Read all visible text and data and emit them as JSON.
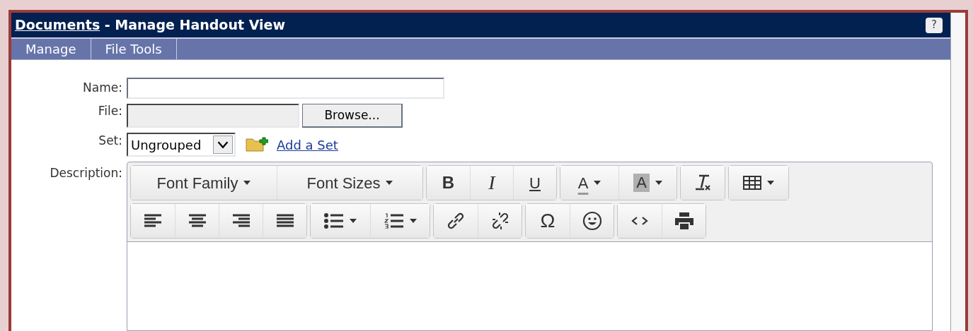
{
  "window": {
    "title_link": "Documents",
    "title": " - Manage Handout View",
    "help": "?"
  },
  "tabs": [
    {
      "label": "Manage",
      "selected": false
    },
    {
      "label": "File Tools",
      "selected": false
    }
  ],
  "form": {
    "name_label": "Name:",
    "file_label": "File:",
    "browse": "Browse...",
    "set_label": "Set:",
    "set_value": "Ungrouped",
    "add_set": "Add a Set",
    "description_label": "Description:"
  },
  "toolbar": [
    [
      [
        {
          "kind": "select",
          "label": "Font Family"
        },
        {
          "kind": "select",
          "label": "Font Sizes"
        }
      ],
      [
        {
          "kind": "bold",
          "label": "B"
        },
        {
          "kind": "italic",
          "label": "I"
        },
        {
          "kind": "underline",
          "label": "U"
        }
      ],
      [
        {
          "kind": "forecolor",
          "label": "A"
        },
        {
          "kind": "backcolor",
          "label": "A"
        }
      ],
      [
        {
          "kind": "clear"
        }
      ],
      [
        {
          "kind": "table"
        }
      ]
    ],
    [
      [
        {
          "kind": "alignleft"
        },
        {
          "kind": "aligncenter"
        },
        {
          "kind": "alignright"
        },
        {
          "kind": "justify"
        }
      ],
      [
        {
          "kind": "bullist"
        },
        {
          "kind": "numlist"
        }
      ],
      [
        {
          "kind": "link"
        },
        {
          "kind": "unlink"
        }
      ],
      [
        {
          "kind": "charmap",
          "label": "Ω"
        },
        {
          "kind": "emoticons"
        }
      ],
      [
        {
          "kind": "code"
        },
        {
          "kind": "print"
        }
      ]
    ]
  ]
}
